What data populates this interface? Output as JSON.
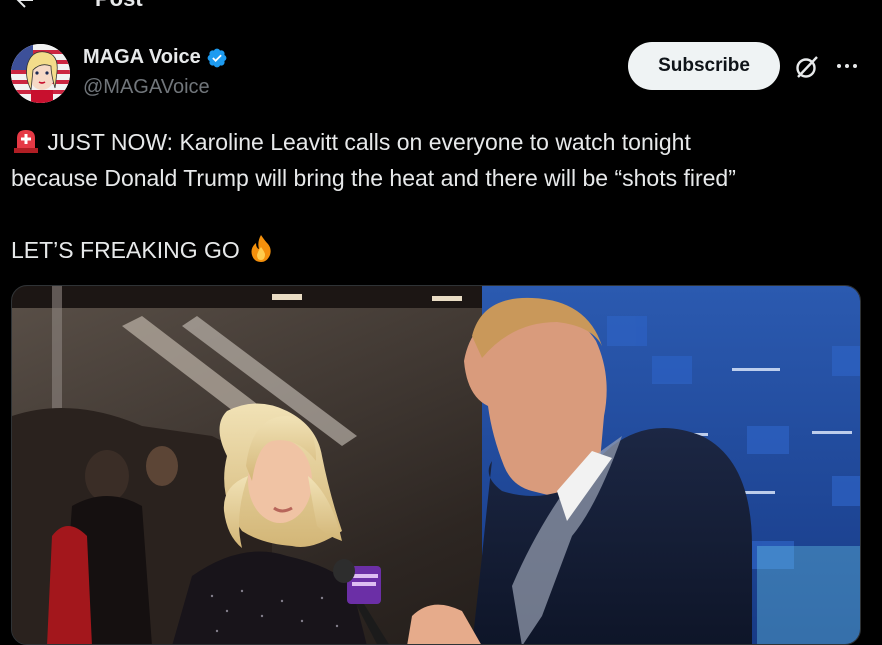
{
  "header": {
    "title": "Post"
  },
  "author": {
    "display_name": "MAGA Voice",
    "handle": "@MAGAVoice"
  },
  "actions": {
    "subscribe_label": "Subscribe"
  },
  "icons": {
    "back": "arrow-left-icon",
    "verified": "verified-badge-icon",
    "grok": "grok-icon",
    "more": "more-horizontal-icon",
    "siren": "rotating-light-emoji",
    "fire": "fire-emoji"
  },
  "tweet": {
    "line1": "JUST NOW: Karoline Leavitt calls on everyone to watch tonight",
    "line2": "because Donald Trump will bring the heat and there will be “shots fired”",
    "line3": "LET’S FREAKING GO"
  },
  "colors": {
    "background": "#000000",
    "text": "#e7e9ea",
    "secondary_text": "#71767b",
    "verified": "#1d9bf0",
    "subscribe_bg": "#eff3f4"
  }
}
